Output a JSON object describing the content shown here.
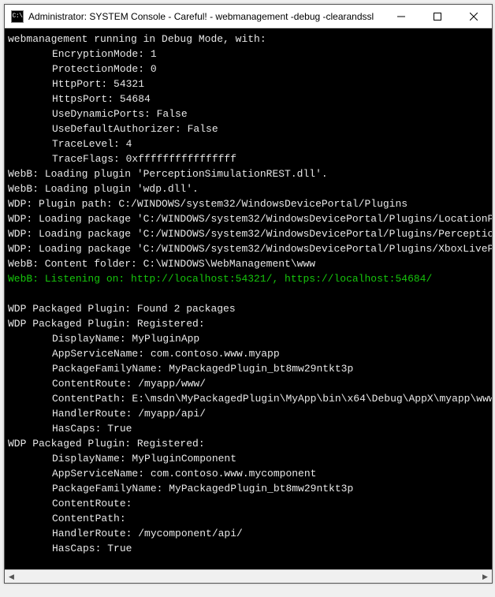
{
  "titlebar": {
    "icon_label": "C:\\",
    "title": "Administrator:  SYSTEM Console - Careful! - webmanagement  -debug -clearandssl"
  },
  "console": {
    "header": "webmanagement running in Debug Mode, with:",
    "settings": {
      "EncryptionMode": "EncryptionMode: 1",
      "ProtectionMode": "ProtectionMode: 0",
      "HttpPort": "HttpPort: 54321",
      "HttpsPort": "HttpsPort: 54684",
      "UseDynamicPorts": "UseDynamicPorts: False",
      "UseDefaultAuthorizer": "UseDefaultAuthorizer: False",
      "TraceLevel": "TraceLevel: 4",
      "TraceFlags": "TraceFlags: 0xffffffffffffffff"
    },
    "load_plugin_1": "WebB: Loading plugin 'PerceptionSimulationREST.dll'.",
    "load_plugin_2": "WebB: Loading plugin 'wdp.dll'.",
    "wdp_path": "WDP: Plugin path: C:/WINDOWS/system32/WindowsDevicePortal/Plugins",
    "wdp_pkg_1": "WDP: Loading package 'C:/WINDOWS/system32/WindowsDevicePortal/Plugins/LocationPlugin",
    "wdp_pkg_2": "WDP: Loading package 'C:/WINDOWS/system32/WindowsDevicePortal/Plugins/Perception/pac",
    "wdp_pkg_3": "WDP: Loading package 'C:/WINDOWS/system32/WindowsDevicePortal/Plugins/XboxLivePlugin",
    "content_folder": "WebB: Content folder: C:\\WINDOWS\\WebManagement\\www",
    "listening": "WebB: Listening on: http://localhost:54321/, https://localhost:54684/",
    "blank": " ",
    "pkg_found": "WDP Packaged Plugin: Found 2 packages",
    "pkg1": {
      "header": "WDP Packaged Plugin: Registered:",
      "DisplayName": "DisplayName: MyPluginApp",
      "AppServiceName": "AppServiceName: com.contoso.www.myapp",
      "PackageFamilyName": "PackageFamilyName: MyPackagedPlugin_bt8mw29ntkt3p",
      "ContentRoute": "ContentRoute: /myapp/www/",
      "ContentPath": "ContentPath: E:\\msdn\\MyPackagedPlugin\\MyApp\\bin\\x64\\Debug\\AppX\\myapp\\www\\",
      "HandlerRoute": "HandlerRoute: /myapp/api/",
      "HasCaps": "HasCaps: True"
    },
    "pkg2": {
      "header": "WDP Packaged Plugin: Registered:",
      "DisplayName": "DisplayName: MyPluginComponent",
      "AppServiceName": "AppServiceName: com.contoso.www.mycomponent",
      "PackageFamilyName": "PackageFamilyName: MyPackagedPlugin_bt8mw29ntkt3p",
      "ContentRoute": "ContentRoute:",
      "ContentPath": "ContentPath:",
      "HandlerRoute": "HandlerRoute: /mycomponent/api/",
      "HasCaps": "HasCaps: True"
    }
  }
}
